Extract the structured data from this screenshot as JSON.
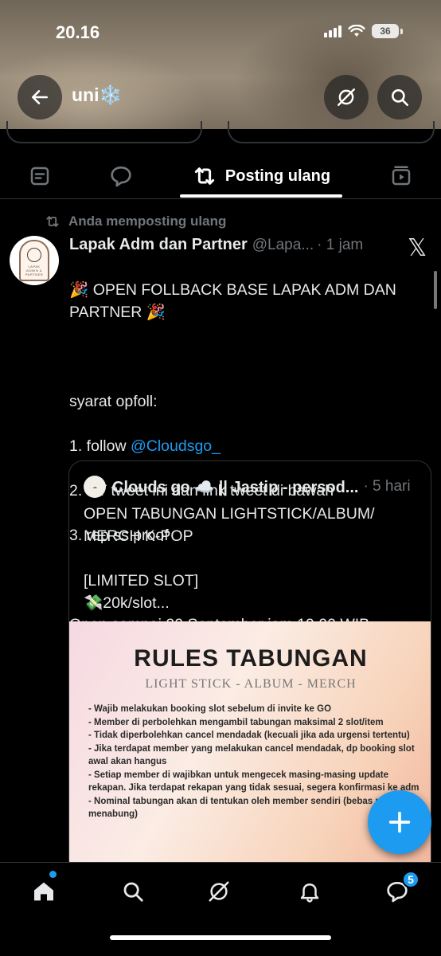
{
  "status_bar": {
    "time": "20.16",
    "battery": "36"
  },
  "header": {
    "profile_name": "uni",
    "profile_emoji": "❄️"
  },
  "tabs": {
    "active_label": "Posting ulang"
  },
  "repost": {
    "label": "Anda memposting ulang"
  },
  "tweet": {
    "name": "Lapak Adm dan Partner",
    "handle": "@Lapa...",
    "time": "· 1 jam",
    "line1": "🎉 OPEN FOLLBACK BASE LAPAK ADM DAN PARTNER 🎉",
    "line2": "syarat opfoll:",
    "line3_prefix": "1. follow ",
    "mention": "@Cloudsgo_",
    "line4": "2. RT tweet ini dan link tweet di bawah",
    "line5": "3. rep ss proof",
    "line6": "Open sampai 20 September jam 19.00 WIB"
  },
  "quote": {
    "name": "Clouds go ☁️ || Jastip - persod...",
    "time": "· 5 hari",
    "body": "OPEN TABUNGAN LIGHTSTICK/ALBUM/\nMERCH K-POP\n\n[LIMITED SLOT]\n💸20k/slot...",
    "image": {
      "title": "RULES TABUNGAN",
      "subtitle": "LIGHT STICK - ALBUM - MERCH",
      "rules": [
        "- Wajib melakukan booking slot sebelum di invite ke GO",
        "- Member di perbolehkan mengambil tabungan maksimal 2 slot/item",
        "- Tidak diperbolehkan cancel mendadak (kecuali jika ada urgensi tertentu)",
        "- Jika terdapat member yang melakukan cancel mendadak, dp booking slot awal akan hangus",
        "- Setiap member di wajibkan untuk mengecek masing-masing update rekapan. Jika terdapat rekapan yang tidak sesuai, segera konfirmasi ke adm",
        "- Nominal tabungan akan di tentukan oleh member sendiri (bebas nominal menabung)"
      ]
    }
  },
  "nav": {
    "messages_badge": "5"
  },
  "colors": {
    "accent": "#1d9bf0",
    "background": "#000000",
    "muted": "#71767b"
  }
}
